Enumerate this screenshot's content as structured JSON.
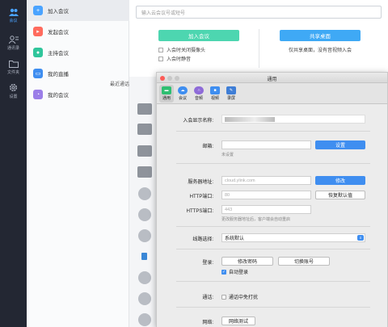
{
  "rail": {
    "items": [
      {
        "label": "会议",
        "icon": "users-icon"
      },
      {
        "label": "通讯录",
        "icon": "contacts-icon"
      },
      {
        "label": "文件夹",
        "icon": "folder-icon"
      },
      {
        "label": "设置",
        "icon": "gear-icon"
      }
    ]
  },
  "menu": {
    "items": [
      {
        "label": "加入会议",
        "color": "#4aa3ff",
        "icon": "plus-icon"
      },
      {
        "label": "发起会议",
        "color": "#ff6b5e",
        "icon": "start-meeting-icon"
      },
      {
        "label": "主持会议",
        "color": "#2fc59b",
        "icon": "host-icon"
      },
      {
        "label": "我的直播",
        "color": "#3f8ef0",
        "icon": "live-icon"
      },
      {
        "label": "我的会议",
        "color": "#9b7ee8",
        "icon": "clock-icon"
      }
    ],
    "recent_label": "最近通话"
  },
  "main": {
    "search_placeholder": "输入云会议号或短号",
    "join_button": "加入会议",
    "share_button": "共享桌面",
    "option_camera_off": "入会时关闭摄像头",
    "option_mute": "入会时静音",
    "share_tip": "仅共享桌面，没有音视频入会"
  },
  "dialog": {
    "title": "通用",
    "tabs": [
      {
        "label": "通用",
        "color": "#2fbf71"
      },
      {
        "label": "会议",
        "color": "#3f8ef0"
      },
      {
        "label": "音频",
        "color": "#8e6bd8"
      },
      {
        "label": "视频",
        "color": "#3f8ef0"
      },
      {
        "label": "录屏",
        "color": "#3f7ed6"
      }
    ],
    "display_name_label": "入会显示名称:",
    "email_label": "邮箱:",
    "email_button": "设置",
    "email_hint": "未设置",
    "server_label": "服务器地址:",
    "server_value": "cloud.ylink.com",
    "server_button": "修改",
    "http_label": "HTTP端口:",
    "http_value": "80",
    "https_label": "HTTPS端口:",
    "https_value": "443",
    "restore_button": "恢复默认值",
    "port_hint": "更改服务器地址后，客户端会自动重启",
    "route_label": "线路选择:",
    "route_value": "系统默认",
    "login_label": "登录:",
    "change_password_button": "修改密码",
    "switch_account_button": "切换账号",
    "auto_login_label": "自动登录",
    "call_label": "通话:",
    "dnd_label": "通话中免打扰",
    "network_label": "网络:",
    "network_test_button": "网络测试"
  }
}
